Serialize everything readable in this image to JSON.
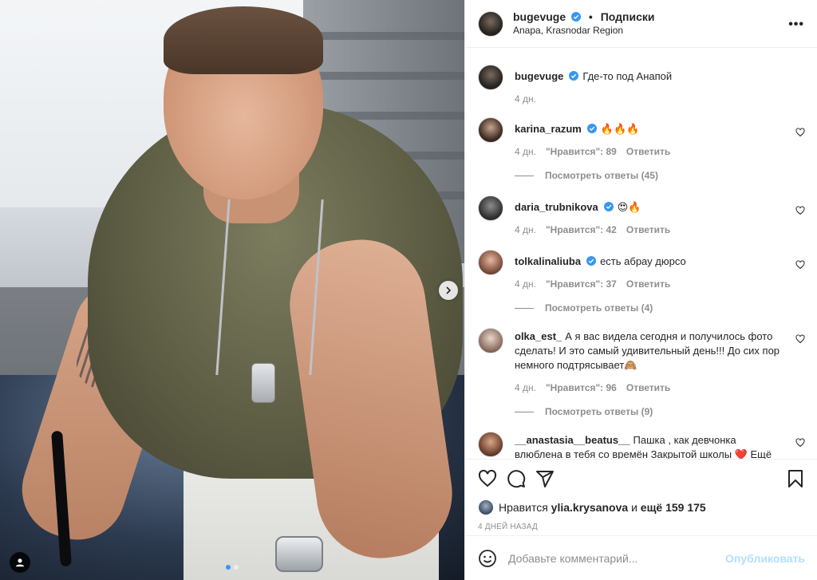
{
  "post": {
    "username": "bugevuge",
    "follow_label": "Подписки",
    "dot": "•",
    "location": "Anapa, Krasnodar Region",
    "more_label": "•••",
    "caption_text": "Где-то под Анапой",
    "caption_time": "4 дн."
  },
  "comments": [
    {
      "username": "karina_razum",
      "verified": true,
      "text": "🔥🔥🔥",
      "time": "4 дн.",
      "likes": "\"Нравится\": 89",
      "reply": "Ответить",
      "replies": "Посмотреть ответы (45)"
    },
    {
      "username": "daria_trubnikova",
      "verified": true,
      "text": "😍🔥",
      "time": "4 дн.",
      "likes": "\"Нравится\": 42",
      "reply": "Ответить",
      "replies": ""
    },
    {
      "username": "tolkalinaliuba",
      "verified": true,
      "text": "есть абрау дюрсо",
      "time": "4 дн.",
      "likes": "\"Нравится\": 37",
      "reply": "Ответить",
      "replies": "Посмотреть ответы (4)"
    },
    {
      "username": "olka_est_",
      "verified": false,
      "text": "А я вас видела сегодня и получилось фото сделать! И это самый удивительный день!!! До сих пор немного подтрясывает🙈",
      "time": "4 дн.",
      "likes": "\"Нравится\": 96",
      "reply": "Ответить",
      "replies": "Посмотреть ответы (9)"
    },
    {
      "username": "__anastasia__beatus__",
      "verified": false,
      "text": "Пашка , как девчонка влюблена в тебя со времён Закрытой школы ❤️ Ещё никогда в жизни мне актёры так не западали в душу 😊 спасибо",
      "time": "",
      "likes": "",
      "reply": "",
      "replies": ""
    }
  ],
  "likes_line": {
    "prefix": "Нравится",
    "user": "ylia.krysanova",
    "connector": "и",
    "others": "ещё 159 175"
  },
  "timestamp": "4 ДНЕЙ НАЗАД",
  "add_comment": {
    "placeholder": "Добавьте комментарий...",
    "publish_label": "Опубликовать"
  },
  "colors": {
    "accent": "#3897f0",
    "publish_disabled": "#b2dffc",
    "secondary_text": "#8e8e8e"
  }
}
